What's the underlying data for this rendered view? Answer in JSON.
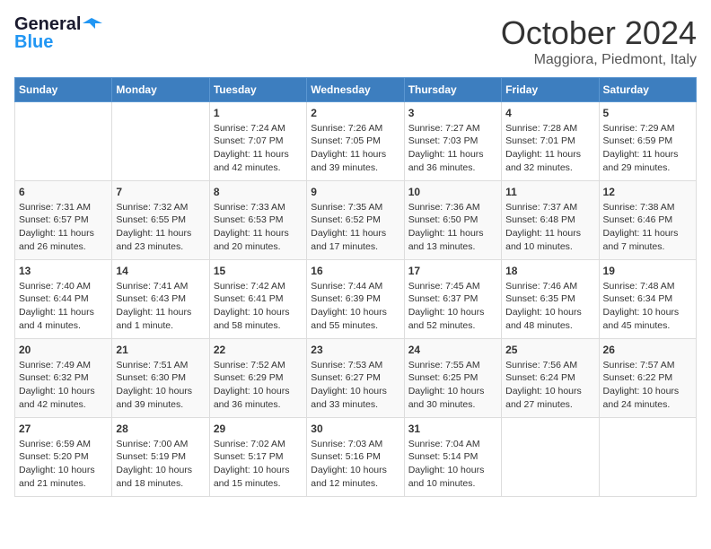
{
  "header": {
    "logo_line1": "General",
    "logo_line2": "Blue",
    "month": "October 2024",
    "location": "Maggiora, Piedmont, Italy"
  },
  "days_of_week": [
    "Sunday",
    "Monday",
    "Tuesday",
    "Wednesday",
    "Thursday",
    "Friday",
    "Saturday"
  ],
  "weeks": [
    [
      {
        "day": "",
        "sunrise": "",
        "sunset": "",
        "daylight": ""
      },
      {
        "day": "",
        "sunrise": "",
        "sunset": "",
        "daylight": ""
      },
      {
        "day": "1",
        "sunrise": "Sunrise: 7:24 AM",
        "sunset": "Sunset: 7:07 PM",
        "daylight": "Daylight: 11 hours and 42 minutes."
      },
      {
        "day": "2",
        "sunrise": "Sunrise: 7:26 AM",
        "sunset": "Sunset: 7:05 PM",
        "daylight": "Daylight: 11 hours and 39 minutes."
      },
      {
        "day": "3",
        "sunrise": "Sunrise: 7:27 AM",
        "sunset": "Sunset: 7:03 PM",
        "daylight": "Daylight: 11 hours and 36 minutes."
      },
      {
        "day": "4",
        "sunrise": "Sunrise: 7:28 AM",
        "sunset": "Sunset: 7:01 PM",
        "daylight": "Daylight: 11 hours and 32 minutes."
      },
      {
        "day": "5",
        "sunrise": "Sunrise: 7:29 AM",
        "sunset": "Sunset: 6:59 PM",
        "daylight": "Daylight: 11 hours and 29 minutes."
      }
    ],
    [
      {
        "day": "6",
        "sunrise": "Sunrise: 7:31 AM",
        "sunset": "Sunset: 6:57 PM",
        "daylight": "Daylight: 11 hours and 26 minutes."
      },
      {
        "day": "7",
        "sunrise": "Sunrise: 7:32 AM",
        "sunset": "Sunset: 6:55 PM",
        "daylight": "Daylight: 11 hours and 23 minutes."
      },
      {
        "day": "8",
        "sunrise": "Sunrise: 7:33 AM",
        "sunset": "Sunset: 6:53 PM",
        "daylight": "Daylight: 11 hours and 20 minutes."
      },
      {
        "day": "9",
        "sunrise": "Sunrise: 7:35 AM",
        "sunset": "Sunset: 6:52 PM",
        "daylight": "Daylight: 11 hours and 17 minutes."
      },
      {
        "day": "10",
        "sunrise": "Sunrise: 7:36 AM",
        "sunset": "Sunset: 6:50 PM",
        "daylight": "Daylight: 11 hours and 13 minutes."
      },
      {
        "day": "11",
        "sunrise": "Sunrise: 7:37 AM",
        "sunset": "Sunset: 6:48 PM",
        "daylight": "Daylight: 11 hours and 10 minutes."
      },
      {
        "day": "12",
        "sunrise": "Sunrise: 7:38 AM",
        "sunset": "Sunset: 6:46 PM",
        "daylight": "Daylight: 11 hours and 7 minutes."
      }
    ],
    [
      {
        "day": "13",
        "sunrise": "Sunrise: 7:40 AM",
        "sunset": "Sunset: 6:44 PM",
        "daylight": "Daylight: 11 hours and 4 minutes."
      },
      {
        "day": "14",
        "sunrise": "Sunrise: 7:41 AM",
        "sunset": "Sunset: 6:43 PM",
        "daylight": "Daylight: 11 hours and 1 minute."
      },
      {
        "day": "15",
        "sunrise": "Sunrise: 7:42 AM",
        "sunset": "Sunset: 6:41 PM",
        "daylight": "Daylight: 10 hours and 58 minutes."
      },
      {
        "day": "16",
        "sunrise": "Sunrise: 7:44 AM",
        "sunset": "Sunset: 6:39 PM",
        "daylight": "Daylight: 10 hours and 55 minutes."
      },
      {
        "day": "17",
        "sunrise": "Sunrise: 7:45 AM",
        "sunset": "Sunset: 6:37 PM",
        "daylight": "Daylight: 10 hours and 52 minutes."
      },
      {
        "day": "18",
        "sunrise": "Sunrise: 7:46 AM",
        "sunset": "Sunset: 6:35 PM",
        "daylight": "Daylight: 10 hours and 48 minutes."
      },
      {
        "day": "19",
        "sunrise": "Sunrise: 7:48 AM",
        "sunset": "Sunset: 6:34 PM",
        "daylight": "Daylight: 10 hours and 45 minutes."
      }
    ],
    [
      {
        "day": "20",
        "sunrise": "Sunrise: 7:49 AM",
        "sunset": "Sunset: 6:32 PM",
        "daylight": "Daylight: 10 hours and 42 minutes."
      },
      {
        "day": "21",
        "sunrise": "Sunrise: 7:51 AM",
        "sunset": "Sunset: 6:30 PM",
        "daylight": "Daylight: 10 hours and 39 minutes."
      },
      {
        "day": "22",
        "sunrise": "Sunrise: 7:52 AM",
        "sunset": "Sunset: 6:29 PM",
        "daylight": "Daylight: 10 hours and 36 minutes."
      },
      {
        "day": "23",
        "sunrise": "Sunrise: 7:53 AM",
        "sunset": "Sunset: 6:27 PM",
        "daylight": "Daylight: 10 hours and 33 minutes."
      },
      {
        "day": "24",
        "sunrise": "Sunrise: 7:55 AM",
        "sunset": "Sunset: 6:25 PM",
        "daylight": "Daylight: 10 hours and 30 minutes."
      },
      {
        "day": "25",
        "sunrise": "Sunrise: 7:56 AM",
        "sunset": "Sunset: 6:24 PM",
        "daylight": "Daylight: 10 hours and 27 minutes."
      },
      {
        "day": "26",
        "sunrise": "Sunrise: 7:57 AM",
        "sunset": "Sunset: 6:22 PM",
        "daylight": "Daylight: 10 hours and 24 minutes."
      }
    ],
    [
      {
        "day": "27",
        "sunrise": "Sunrise: 6:59 AM",
        "sunset": "Sunset: 5:20 PM",
        "daylight": "Daylight: 10 hours and 21 minutes."
      },
      {
        "day": "28",
        "sunrise": "Sunrise: 7:00 AM",
        "sunset": "Sunset: 5:19 PM",
        "daylight": "Daylight: 10 hours and 18 minutes."
      },
      {
        "day": "29",
        "sunrise": "Sunrise: 7:02 AM",
        "sunset": "Sunset: 5:17 PM",
        "daylight": "Daylight: 10 hours and 15 minutes."
      },
      {
        "day": "30",
        "sunrise": "Sunrise: 7:03 AM",
        "sunset": "Sunset: 5:16 PM",
        "daylight": "Daylight: 10 hours and 12 minutes."
      },
      {
        "day": "31",
        "sunrise": "Sunrise: 7:04 AM",
        "sunset": "Sunset: 5:14 PM",
        "daylight": "Daylight: 10 hours and 10 minutes."
      },
      {
        "day": "",
        "sunrise": "",
        "sunset": "",
        "daylight": ""
      },
      {
        "day": "",
        "sunrise": "",
        "sunset": "",
        "daylight": ""
      }
    ]
  ]
}
